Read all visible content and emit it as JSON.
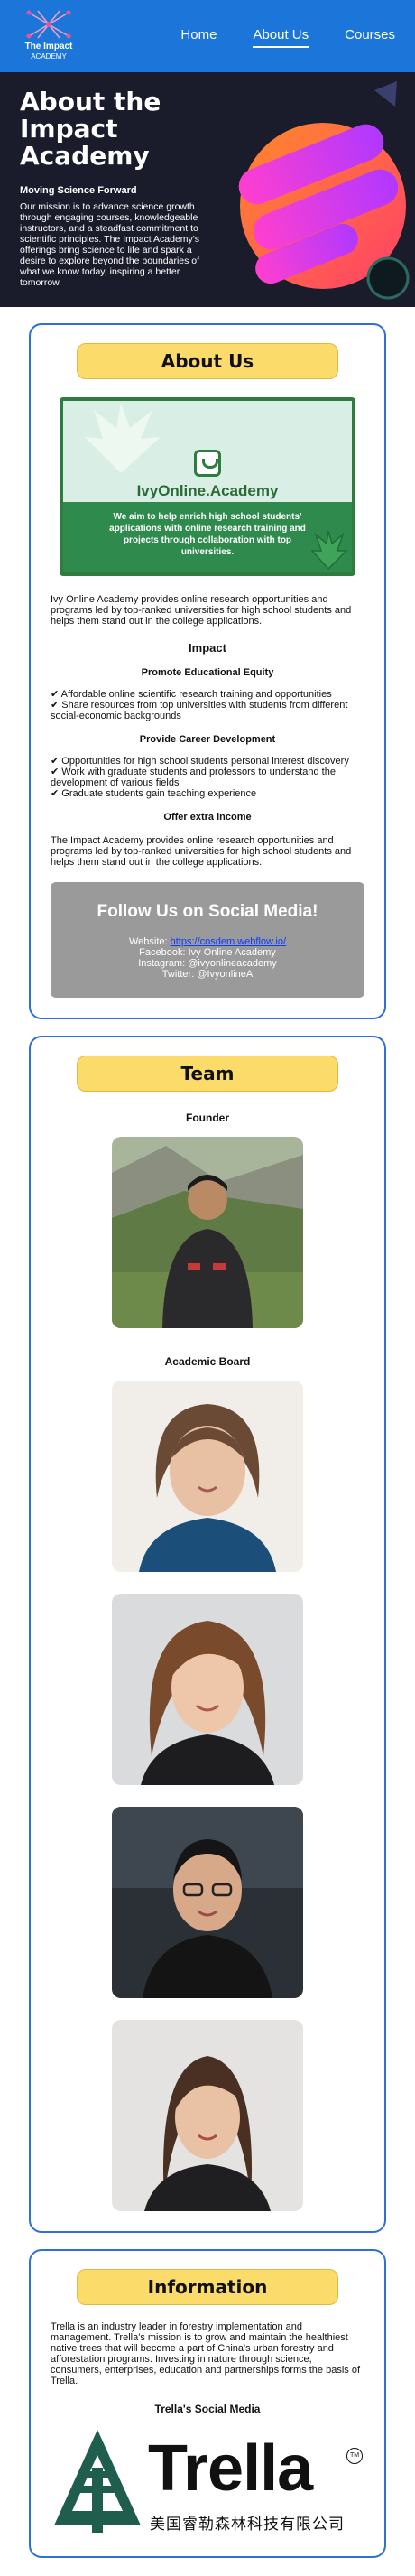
{
  "nav": {
    "logo_line1": "The Impact",
    "logo_line2": "ACADEMY",
    "links": [
      "Home",
      "About Us",
      "Courses"
    ],
    "active_link": "About Us"
  },
  "hero": {
    "title": "About the Impact Academy",
    "subtitle": "Moving Science Forward",
    "body": "Our mission is to advance science growth through engaging courses, knowledgeable instructors, and a steadfast commitment to scientific principles. The Impact Academy's offerings bring science to life and spark a desire to explore beyond the boundaries of what we know today, inspiring a better tomorrow."
  },
  "about": {
    "heading": "About Us",
    "banner": {
      "brand": "IvyOnline.Academy",
      "tagline": "We aim to help enrich high school students' applications with online research training and projects through collaboration with top universities."
    },
    "intro": "Ivy Online Academy provides online research opportunities and programs led by top-ranked universities for high school students and helps them stand out in the college applications.",
    "impact_heading": "Impact",
    "sections": [
      {
        "heading": "Promote Educational Equity",
        "items": [
          "✔ Affordable online scientific research training and opportunities",
          "✔ Share resources from top universities with students from different social-economic backgrounds"
        ]
      },
      {
        "heading": "Provide Career Development",
        "items": [
          "✔ Opportunities for high school students personal interest discovery",
          "✔ Work with graduate students and professors to understand the development of various fields",
          "✔ Graduate students gain teaching experience"
        ]
      },
      {
        "heading": "Offer extra income",
        "items": []
      }
    ],
    "outro": "The Impact Academy provides online research opportunities and programs led by top-ranked universities for high school students and helps them stand out in the college applications.",
    "social": {
      "title": "Follow Us on Social Media!",
      "website_label": "Website: ",
      "website_url": "https://cosdem.webflow.io/",
      "facebook": "Facebook: Ivy Online Academy",
      "instagram": "Instagram: @ivyonlineacademy",
      "twitter": "Twitter: @IvyonlineA"
    }
  },
  "team": {
    "heading": "Team",
    "founder_heading": "Founder",
    "board_heading": "Academic Board"
  },
  "info": {
    "heading": "Information",
    "body": "Trella is an industry leader in forestry implementation and management. Trella's mission is to grow and maintain the healthiest native trees that will become a part of China's urban forestry and afforestation programs. Investing in nature through science, consumers, enterprises, education and partnerships forms the basis of Trella.",
    "social_heading": "Trella's Social Media",
    "logo_word": "Trella",
    "logo_cn": "美国睿勒森林科技有限公司",
    "logo_tm": "TM"
  },
  "colors": {
    "nav_bg": "#1c76d9",
    "hero_bg": "#1b1c2b",
    "card_border": "#2f6fd6",
    "pill_bg": "#fbdc6b",
    "banner_green": "#2f8a4e",
    "social_bg": "#9a9a9a",
    "trella_green": "#1f5e4c"
  }
}
